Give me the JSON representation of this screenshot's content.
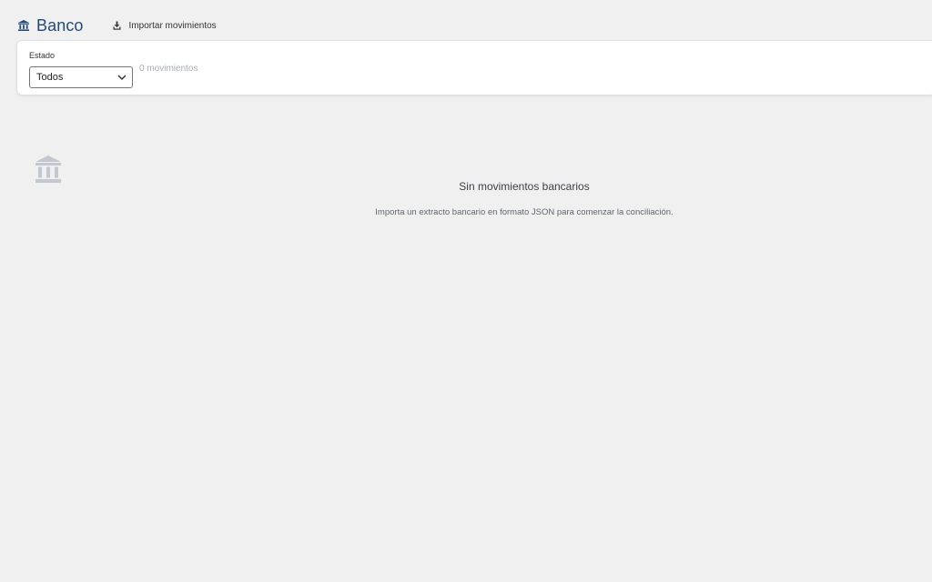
{
  "header": {
    "title": "Banco",
    "title_icon": "bank-icon",
    "import_label": "Importar movimientos",
    "import_icon": "download-icon"
  },
  "filters": {
    "estado_label": "Estado",
    "estado_value": "Todos",
    "count_text": "0 movimientos"
  },
  "empty_state": {
    "icon": "bank-icon",
    "title": "Sin movimientos bancarios",
    "description": "Importa un extracto bancario en formato JSON para comenzar la conciliación."
  },
  "colors": {
    "background": "#f0f0f0",
    "title": "#244a78",
    "empty_icon": "#c3c7cf"
  }
}
